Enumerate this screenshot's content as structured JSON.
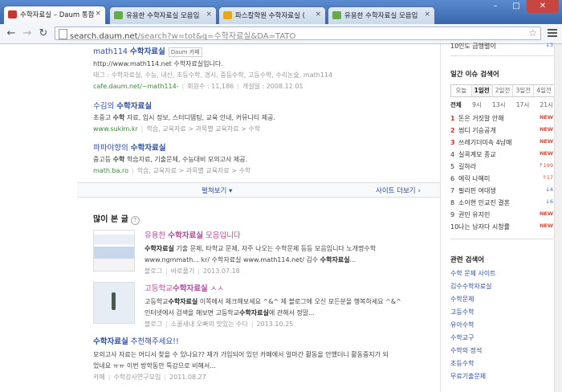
{
  "browser": {
    "tabs": [
      {
        "title": "수학자료실 – Daum 통합",
        "active": true,
        "fav_color": "#c8362f"
      },
      {
        "title": "유용한 수학자료실 모음입",
        "active": false,
        "fav_color": "#6aa84f"
      },
      {
        "title": "파스칼학원 수학자료실 (",
        "active": false,
        "fav_color": "#e6a817"
      },
      {
        "title": "유용한 수학자료실 모음입",
        "active": false,
        "fav_color": "#6aa84f"
      }
    ],
    "url_host": "search.daum.net",
    "url_path": "/search?w=tot&q=수학자료실&DA=TATO",
    "back_glyph": "←",
    "forward_glyph": "→",
    "reload_glyph": "↻",
    "star_glyph": "☆",
    "close_glyph": "×",
    "win_min": "–",
    "win_max": "□",
    "win_close": "✕"
  },
  "results": [
    {
      "title_pre": "math114 ",
      "title_hl": "수학자료실",
      "badge": "Daum 카페",
      "line1": "http://www.math114.net 수학자료실입니다.",
      "line2": "태그 : 수학자료실, 수능, 내신, 초등수학, 경시, 중등수학, 고등수학, 수리논술, math114",
      "meta_url": "cafe.daum.net/~math114-",
      "meta_a": "회원수 : 11,186",
      "meta_b": "개설일 : 2008.12.01"
    },
    {
      "title_pre": "수김의 ",
      "title_hl": "수학자료실",
      "line1_pre": "초중고 ",
      "line1_hl": "수학",
      "line1_post": " 자료, 입시 정보, 스터디템팅, 교육 안내, 커뮤니티 제공.",
      "meta_url": "www.sukim.kr",
      "meta_a": "학습, 교육자료 > 과목별 교육자료 > 수학"
    },
    {
      "title_pre": "파파야향의 ",
      "title_hl": "수학자료실",
      "line1_pre": "중고등 ",
      "line1_hl": "수학",
      "line1_post": " 학습자료, 기출문제, 수능대비 모의고사 제공.",
      "meta_url": "math.ba.ro",
      "meta_a": "학습, 교육자료 > 과목별 교육자료 > 수학"
    }
  ],
  "more_bar": {
    "expand": "펼쳐보기 ▾",
    "more_sites": "사이트 더보기 ›"
  },
  "popular": {
    "heading": "많이 본 글",
    "help": "?",
    "items": [
      {
        "title_pre": "유용한 ",
        "title_hl": "수학자료실",
        "title_post": " 모음입니다",
        "line1_hl": "수학자료실",
        "line1_post": " 기출 문제, 타학교 문제, 자주 나오는 수학문제 등등 모음입니다 노개명수학",
        "line2_pre": "www.ngmmath... kr/ 수학자료실 www.math114.net/ 김수 ",
        "line2_hl": "수학자료실",
        "line2_post": "...",
        "meta_src": "블로그",
        "meta_author": "바로풀기",
        "meta_date": "2013.07.18"
      },
      {
        "title_pre": "고등학교",
        "title_hl": "수학자료실",
        "title_post": " ㅅㅅ",
        "line1_pre": "고등학교",
        "line1_hl": "수학자료실",
        "line1_post": " 이쪽에서 체크해보세요 ^&^ 제 블로그에 오신 모든분을 행복하세요 ^&^",
        "line2_pre": "인터넷에서 검색을 해보면 고등학교",
        "line2_hl": "수학자료실",
        "line2_post": "에 관해서 정말...",
        "meta_src": "블로그",
        "meta_author": "소꿀새내 오빠의 맛있는 수다",
        "meta_date": "2013.10.25"
      },
      {
        "title_hl": "수학자료실",
        "title_post": " 추천해주세요!!",
        "line1": "모의고사 자료는 어디서 찾을 수 있나요?? 제가 가입되어 있던 카페에서 얼마간 활동을 안했더니 활동중지가 되",
        "line2": "었네요 ㅠㅠ 이번 방학동안 특강으로 비해서...",
        "meta_src": "카페",
        "meta_author": "수학강사연구모임",
        "meta_date": "2011.08.27"
      }
    ]
  },
  "right": {
    "top_item": {
      "rank": "10",
      "text": "인도 급행렬이",
      "delta": "↓3"
    },
    "issue_heading": "일간 이슈 검색어",
    "periods": [
      "오늘",
      "1일전",
      "2일전",
      "3일전",
      "4일전"
    ],
    "hours": [
      "전체",
      "9시",
      "13시",
      "17시",
      "21시"
    ],
    "ranks": [
      {
        "n": "1",
        "text": "돈은 거짓말 안해",
        "status": "NEW",
        "kind": "new"
      },
      {
        "n": "2",
        "text": "썸디 기승공개",
        "status": "NEW",
        "kind": "new"
      },
      {
        "n": "3",
        "text": "쓰레기더미속 4남매",
        "status": "NEW",
        "kind": "new"
      },
      {
        "n": "4",
        "text": "실콕계모 종교",
        "status": "NEW",
        "kind": "new"
      },
      {
        "n": "5",
        "text": "길하라",
        "status": "↑199",
        "kind": "up"
      },
      {
        "n": "6",
        "text": "에릭 나혜미",
        "status": "↑17",
        "kind": "up"
      },
      {
        "n": "7",
        "text": "필리핀 여대생",
        "status": "↓4",
        "kind": "dn"
      },
      {
        "n": "8",
        "text": "소이현 인교진 결혼",
        "status": "↓6",
        "kind": "dn"
      },
      {
        "n": "9",
        "text": "권민 유지민",
        "status": "NEW",
        "kind": "new"
      },
      {
        "n": "10",
        "text": "나는 남자다 시청률",
        "status": "NEW",
        "kind": "new"
      }
    ],
    "related_heading": "관련 검색어",
    "related": [
      "수학 문제 사이트",
      "김수수학자료실",
      "수학문제",
      "고등수학",
      "유아수학",
      "수학교구",
      "수학의 정석",
      "초등수학",
      "무료기출문제"
    ]
  }
}
